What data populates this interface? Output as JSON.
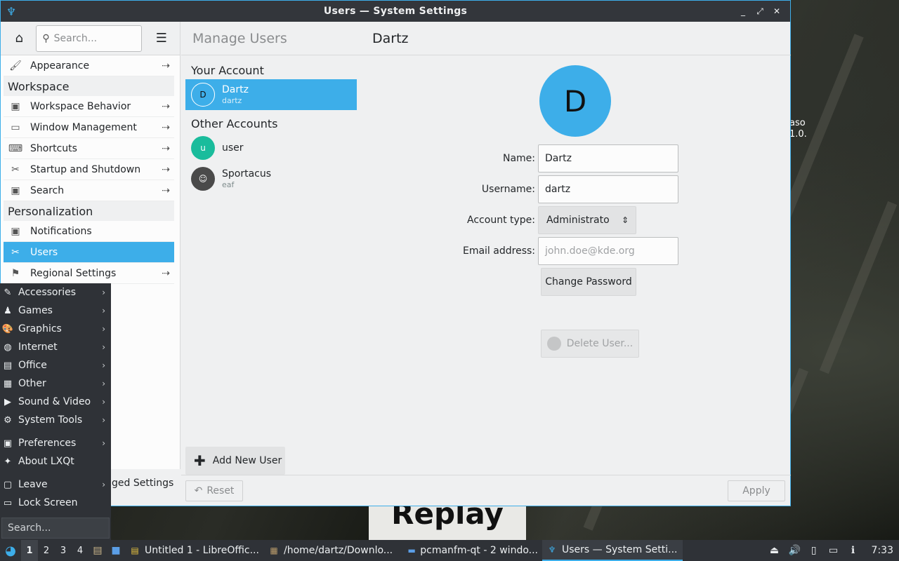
{
  "window": {
    "title": "Users  — System Settings",
    "controls": [
      "_",
      "⤢",
      "✕"
    ]
  },
  "sidebar": {
    "search_placeholder": "Search...",
    "items": [
      {
        "label": "Appearance",
        "icon": "paint-icon",
        "glyph": "🖌",
        "arrow": "⇢",
        "type": "item"
      },
      {
        "label": "Workspace",
        "type": "category"
      },
      {
        "label": "Workspace Behavior",
        "icon": "workspace-icon",
        "glyph": "▣",
        "arrow": "⇢",
        "type": "item"
      },
      {
        "label": "Window Management",
        "icon": "window-icon",
        "glyph": "▭",
        "arrow": "⇢",
        "type": "item"
      },
      {
        "label": "Shortcuts",
        "icon": "keyboard-icon",
        "glyph": "⌨",
        "arrow": "⇢",
        "type": "item"
      },
      {
        "label": "Startup and Shutdown",
        "icon": "tools-icon",
        "glyph": "✂",
        "arrow": "⇢",
        "type": "item"
      },
      {
        "label": "Search",
        "icon": "search-settings-icon",
        "glyph": "▣",
        "arrow": "⇢",
        "type": "item"
      },
      {
        "label": "Personalization",
        "type": "category"
      },
      {
        "label": "Notifications",
        "icon": "notifications-icon",
        "glyph": "▣",
        "arrow": "",
        "type": "item"
      },
      {
        "label": "Users",
        "icon": "users-icon",
        "glyph": "✂",
        "arrow": "",
        "type": "item",
        "selected": true
      },
      {
        "label": "Regional Settings",
        "icon": "flag-icon",
        "glyph": "⚑",
        "arrow": "⇢",
        "type": "item"
      }
    ],
    "bottom_label": "ged Settings"
  },
  "header": {
    "breadcrumb": "Manage Users",
    "page_title": "Dartz"
  },
  "accounts": {
    "your_account_title": "Your Account",
    "other_accounts_title": "Other Accounts",
    "current": {
      "name": "Dartz",
      "username": "dartz",
      "initial": "D",
      "color": "#3daee9"
    },
    "others": [
      {
        "name": "user",
        "username": "",
        "initial": "u",
        "color": "#1abc9c"
      },
      {
        "name": "Sportacus",
        "username": "eaf",
        "initial": "☺",
        "color": "#4a4a4a"
      }
    ]
  },
  "form": {
    "avatar_initial": "D",
    "name_label": "Name:",
    "name_value": "Dartz",
    "username_label": "Username:",
    "username_value": "dartz",
    "account_type_label": "Account type:",
    "account_type_value": "Administrato",
    "email_label": "Email address:",
    "email_placeholder": "john.doe@kde.org",
    "change_password": "Change Password",
    "delete_user": "Delete User..."
  },
  "actions": {
    "add_user": "Add New User",
    "reset": "Reset",
    "apply": "Apply"
  },
  "startmenu": {
    "groups": [
      [
        {
          "label": "Accessories",
          "icon": "accessories-icon",
          "glyph": "✎",
          "submenu": true
        },
        {
          "label": "Games",
          "icon": "games-icon",
          "glyph": "♟",
          "submenu": true
        },
        {
          "label": "Graphics",
          "icon": "graphics-icon",
          "glyph": "🎨",
          "submenu": true
        },
        {
          "label": "Internet",
          "icon": "internet-icon",
          "glyph": "◍",
          "submenu": true
        },
        {
          "label": "Office",
          "icon": "office-icon",
          "glyph": "▤",
          "submenu": true
        },
        {
          "label": "Other",
          "icon": "other-icon",
          "glyph": "▦",
          "submenu": true
        },
        {
          "label": "Sound & Video",
          "icon": "media-icon",
          "glyph": "▶",
          "submenu": true
        },
        {
          "label": "System Tools",
          "icon": "system-tools-icon",
          "glyph": "⚙",
          "submenu": true
        }
      ],
      [
        {
          "label": "Preferences",
          "icon": "preferences-icon",
          "glyph": "▣",
          "submenu": true
        },
        {
          "label": "About LXQt",
          "icon": "about-icon",
          "glyph": "✦",
          "submenu": false
        }
      ],
      [
        {
          "label": "Leave",
          "icon": "leave-icon",
          "glyph": "▢",
          "submenu": true
        },
        {
          "label": "Lock Screen",
          "icon": "lock-screen-icon",
          "glyph": "▭",
          "submenu": false
        }
      ]
    ],
    "search_placeholder": "Search..."
  },
  "desktop": {
    "text_line1": "aso",
    "text_line2": "1.0.",
    "replay_text": "Replay"
  },
  "taskbar": {
    "desktops": [
      "1",
      "2",
      "3",
      "4"
    ],
    "tasks": [
      {
        "label": "Untitled 1 - LibreOffic...",
        "icon": "libreoffice-icon",
        "glyph": "▤",
        "color": "#e8c440",
        "active": false
      },
      {
        "label": "/home/dartz/Downlo...",
        "icon": "archive-icon",
        "glyph": "▦",
        "color": "#b89a6a",
        "active": false
      },
      {
        "label": "pcmanfm-qt - 2 windo...",
        "icon": "folder-icon",
        "glyph": "▬",
        "color": "#5b9ee6",
        "active": false
      },
      {
        "label": "Users  — System Setti...",
        "icon": "system-settings-icon",
        "glyph": "♆",
        "color": "#3daee9",
        "active": true
      }
    ],
    "clock": "7:33"
  }
}
